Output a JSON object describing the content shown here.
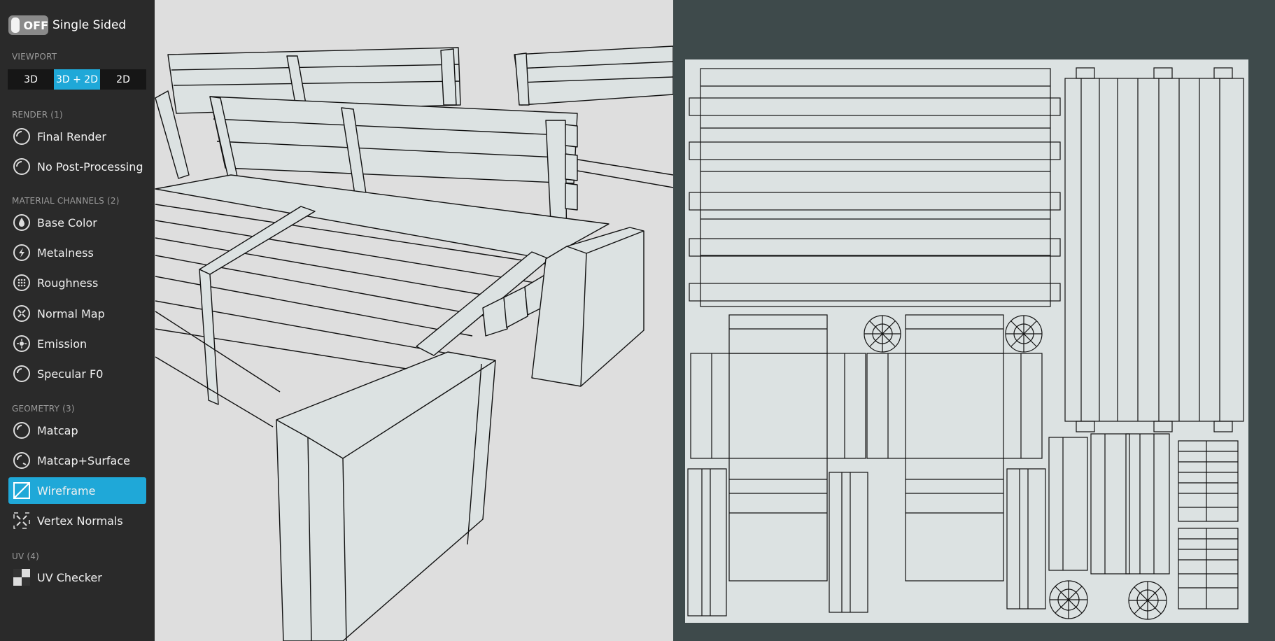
{
  "toggle": {
    "state": "OFF",
    "label": "Single Sided"
  },
  "viewport": {
    "heading": "VIEWPORT",
    "modes": [
      "3D",
      "3D + 2D",
      "2D"
    ],
    "selected": "3D + 2D"
  },
  "render": {
    "heading": "RENDER (1)",
    "items": [
      "Final Render",
      "No Post-Processing"
    ]
  },
  "material": {
    "heading": "MATERIAL CHANNELS (2)",
    "items": [
      "Base Color",
      "Metalness",
      "Roughness",
      "Normal Map",
      "Emission",
      "Specular F0"
    ]
  },
  "geometry": {
    "heading": "GEOMETRY (3)",
    "items": [
      "Matcap",
      "Matcap+Surface",
      "Wireframe",
      "Vertex Normals"
    ],
    "selected": "Wireframe"
  },
  "uv": {
    "heading": "UV (4)",
    "items": [
      "UV Checker"
    ]
  },
  "colors": {
    "accent": "#1fa8d8",
    "sidebar": "#1c1c1c",
    "uv_background": "#3e4a4b",
    "uv_sheet": "#dce2e2",
    "model_fill": "#dce2e2"
  }
}
